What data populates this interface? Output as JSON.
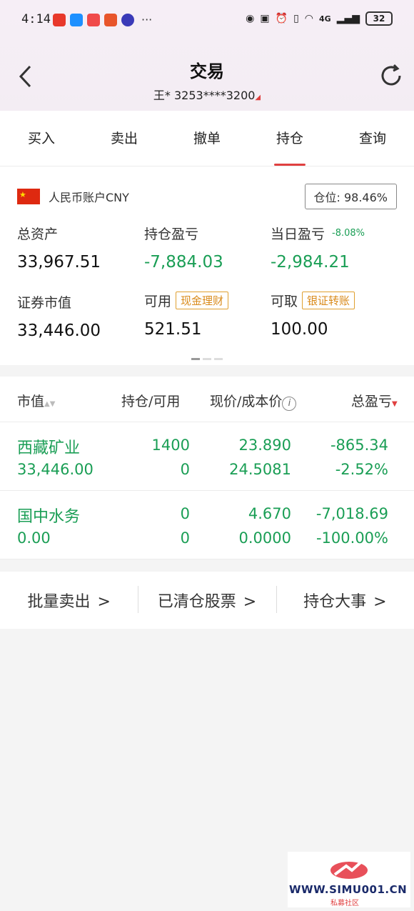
{
  "status_bar": {
    "time": "4:14",
    "network": "4G",
    "battery": "32"
  },
  "header": {
    "title": "交易",
    "account_name": "王*",
    "account_number": "3253****3200"
  },
  "tabs": [
    {
      "label": "买入"
    },
    {
      "label": "卖出"
    },
    {
      "label": "撤单"
    },
    {
      "label": "持仓",
      "active": true
    },
    {
      "label": "查询"
    }
  ],
  "account": {
    "currency_label": "人民币账户CNY",
    "position_ratio": "仓位:  98.46%",
    "total_assets_label": "总资产",
    "total_assets": "33,967.51",
    "position_pl_label": "持仓盈亏",
    "position_pl": "-7,884.03",
    "daily_pl_label": "当日盈亏",
    "daily_pl_pct": "-8.08%",
    "daily_pl": "-2,984.21",
    "market_value_label": "证券市值",
    "market_value": "33,446.00",
    "available_label": "可用",
    "available_tag": "现金理财",
    "available": "521.51",
    "withdrawable_label": "可取",
    "withdrawable_tag": "银证转账",
    "withdrawable": "100.00"
  },
  "holdings": {
    "headers": {
      "market_value": "市值",
      "position_available": "持仓/可用",
      "price_cost": "现价/成本价",
      "total_pl": "总盈亏"
    },
    "rows": [
      {
        "name": "西藏矿业",
        "market_value": "33,446.00",
        "position": "1400",
        "available": "0",
        "price": "23.890",
        "cost": "24.5081",
        "pl": "-865.34",
        "pl_pct": "-2.52%"
      },
      {
        "name": "国中水务",
        "market_value": "0.00",
        "position": "0",
        "available": "0",
        "price": "4.670",
        "cost": "0.0000",
        "pl": "-7,018.69",
        "pl_pct": "-100.00%"
      }
    ]
  },
  "links": {
    "batch_sell": "批量卖出",
    "cleared_stocks": "已清仓股票",
    "position_events": "持仓大事"
  },
  "watermark": {
    "site": "WWW.SIMU001.CN",
    "caption": "私募社区"
  },
  "colors": {
    "loss_green": "#1a9e55",
    "accent_red": "#e04040",
    "tag_orange": "#d98a1a"
  }
}
